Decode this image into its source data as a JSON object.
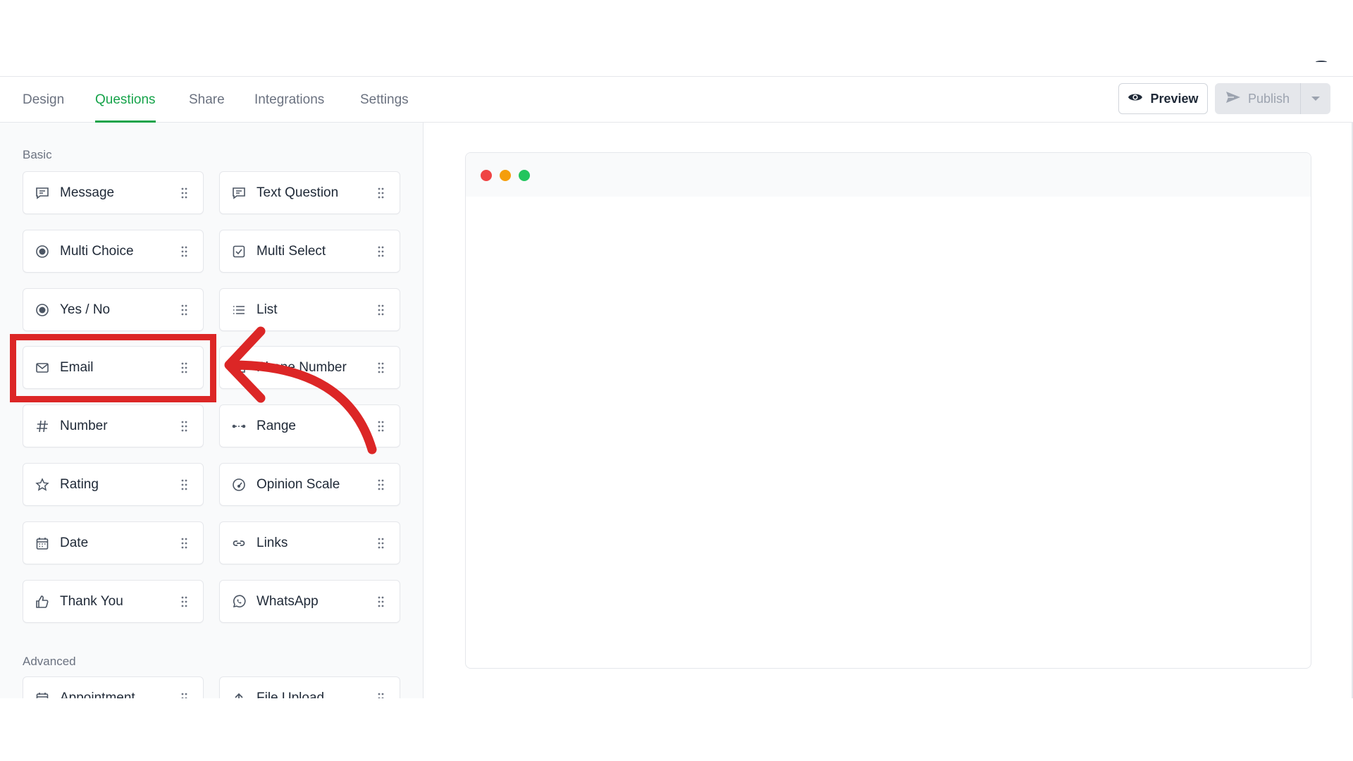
{
  "tabs": [
    {
      "label": "Design"
    },
    {
      "label": "Questions"
    },
    {
      "label": "Share"
    },
    {
      "label": "Integrations"
    },
    {
      "label": "Settings"
    }
  ],
  "active_tab": "Questions",
  "header": {
    "preview_label": "Preview",
    "publish_label": "Publish"
  },
  "sidebar": {
    "basic_label": "Basic",
    "advanced_label": "Advanced",
    "basic": [
      {
        "label": "Message",
        "icon": "message-icon"
      },
      {
        "label": "Text Question",
        "icon": "text-question-icon"
      },
      {
        "label": "Multi Choice",
        "icon": "radio-icon"
      },
      {
        "label": "Multi Select",
        "icon": "checkbox-icon"
      },
      {
        "label": "Yes / No",
        "icon": "radio-icon"
      },
      {
        "label": "List",
        "icon": "list-icon"
      },
      {
        "label": "Email",
        "icon": "envelope-icon"
      },
      {
        "label": "Phone Number",
        "icon": "phone-icon"
      },
      {
        "label": "Number",
        "icon": "hash-icon"
      },
      {
        "label": "Range",
        "icon": "range-icon"
      },
      {
        "label": "Rating",
        "icon": "star-icon"
      },
      {
        "label": "Opinion Scale",
        "icon": "gauge-icon"
      },
      {
        "label": "Date",
        "icon": "calendar-icon"
      },
      {
        "label": "Links",
        "icon": "link-icon"
      },
      {
        "label": "Thank You",
        "icon": "thumbs-up-icon"
      },
      {
        "label": "WhatsApp",
        "icon": "whatsapp-icon"
      }
    ],
    "advanced": [
      {
        "label": "Appointment",
        "icon": "calendar-icon"
      },
      {
        "label": "File Upload",
        "icon": "upload-icon"
      }
    ]
  },
  "colors": {
    "accent": "#16a34a",
    "annotation": "#dc2626",
    "dot_red": "#ef4444",
    "dot_yellow": "#f59e0b",
    "dot_green": "#22c55e"
  }
}
